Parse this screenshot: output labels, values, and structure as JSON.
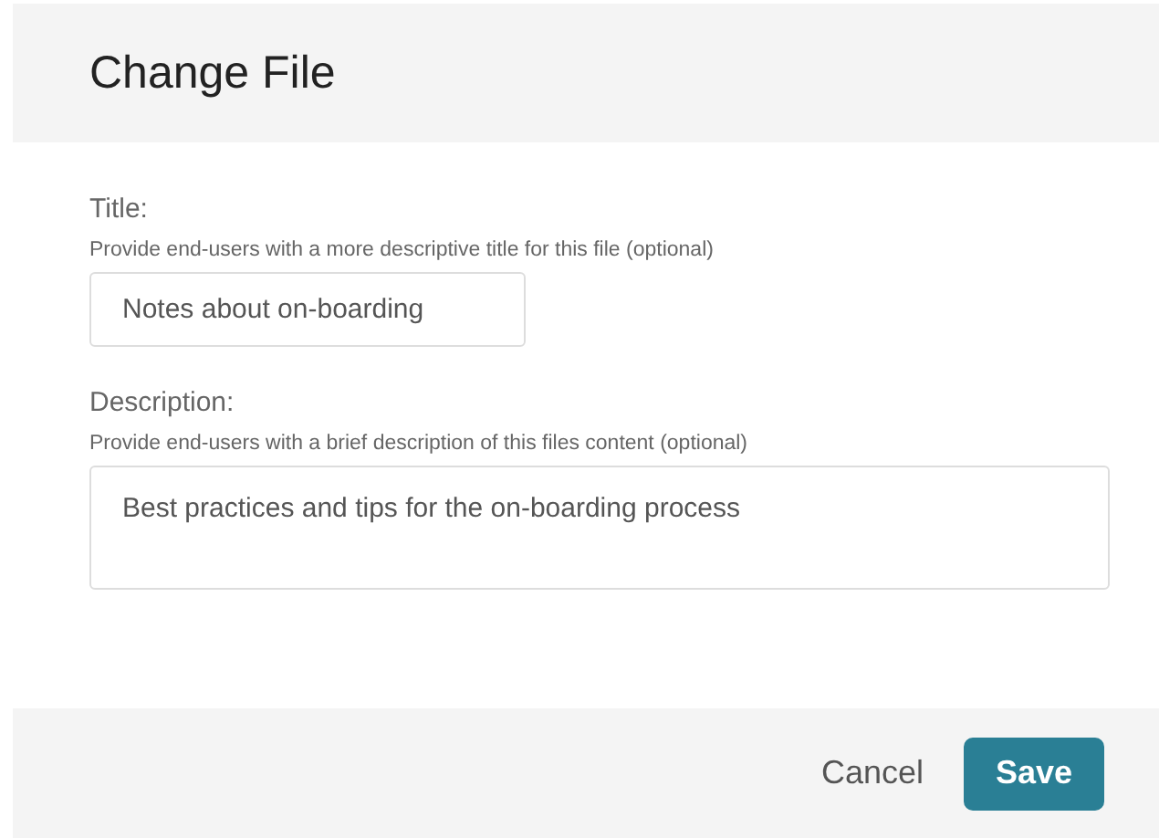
{
  "dialog": {
    "title": "Change File"
  },
  "fields": [
    {
      "kind": "input",
      "label": "Title:",
      "hint": "Provide end-users with a more descriptive title for this file (optional)",
      "value": "Notes about on-boarding"
    },
    {
      "kind": "textarea",
      "label": "Description:",
      "hint": "Provide end-users with a brief description of this files content (optional)",
      "value": "Best practices and tips for the on-boarding process"
    }
  ],
  "buttons": [
    {
      "kind": "secondary",
      "label": "Cancel"
    },
    {
      "kind": "primary",
      "label": "Save"
    }
  ]
}
